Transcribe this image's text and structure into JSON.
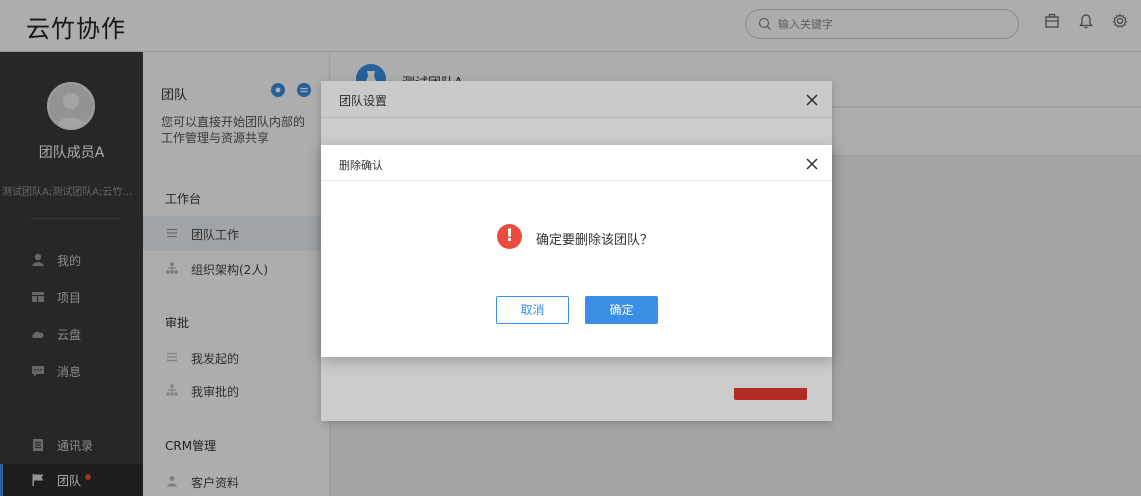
{
  "topbar": {
    "logo": "云竹协作",
    "search_placeholder": "输入关键字"
  },
  "user": {
    "name": "团队成员A",
    "teams": "测试团队A;测试团队A;云竹协..."
  },
  "nav": [
    {
      "label": "我的",
      "icon": "user-icon"
    },
    {
      "label": "项目",
      "icon": "project-icon"
    },
    {
      "label": "云盘",
      "icon": "cloud-icon"
    },
    {
      "label": "消息",
      "icon": "message-icon"
    },
    {
      "label": "通讯录",
      "icon": "contacts-icon"
    },
    {
      "label": "团队",
      "icon": "flag-icon",
      "active": true,
      "badge": true
    }
  ],
  "panel": {
    "title": "团队",
    "desc": "您可以直接开始团队内部的工作管理与资源共享",
    "sections": [
      {
        "heading": "工作台",
        "items": [
          {
            "label": "团队工作",
            "active": true
          },
          {
            "label": "组织架构(2人)"
          }
        ]
      },
      {
        "heading": "审批",
        "items": [
          {
            "label": "我发起的"
          },
          {
            "label": "我审批的"
          }
        ]
      },
      {
        "heading": "CRM管理",
        "items": [
          {
            "label": "客户资料"
          }
        ]
      }
    ]
  },
  "main": {
    "team_name": "测试团队A"
  },
  "settings_dialog": {
    "title": "团队设置"
  },
  "confirm_dialog": {
    "title": "删除确认",
    "message": "确定要删除该团队？",
    "cancel_label": "取消",
    "ok_label": "确定"
  },
  "colors": {
    "accent": "#3a8ee6",
    "danger": "#ec4b3f",
    "sidebar_bg": "#3a3a3a"
  }
}
